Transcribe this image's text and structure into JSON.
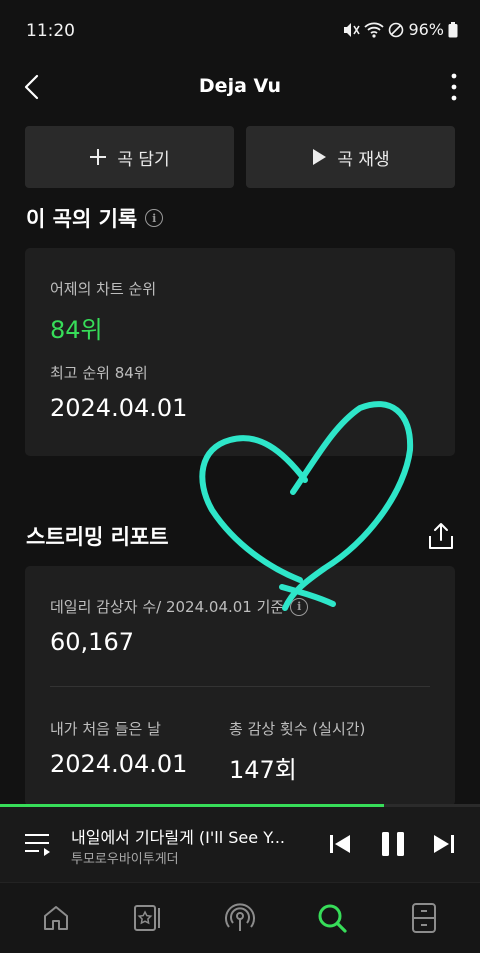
{
  "status": {
    "time": "11:20",
    "battery": "96%"
  },
  "header": {
    "title": "Deja Vu"
  },
  "actions": {
    "add_label": "곡 담기",
    "play_label": "곡 재생"
  },
  "history": {
    "title": "이 곡의 기록",
    "yesterday_label": "어제의 차트 순위",
    "yesterday_value": "84위",
    "best_label": "최고 순위 84위",
    "best_date": "2024.04.01"
  },
  "report": {
    "title": "스트리밍 리포트",
    "daily_label": "데일리 감상자 수/ 2024.04.01 기준",
    "daily_value": "60,167",
    "first_label": "내가 처음 들은 날",
    "first_value": "2024.04.01",
    "total_label": "총 감상 횟수 (실시간)",
    "total_value": "147회"
  },
  "player": {
    "title": "내일에서 기다릴게 (I'll See Y...",
    "artist": "투모로우바이투게더",
    "progress": 0.8
  },
  "colors": {
    "accent": "#37dd59",
    "annotation": "#2ee6c9"
  },
  "icons": [
    "home-icon",
    "library-icon",
    "podcast-icon",
    "search-icon",
    "storage-icon"
  ]
}
